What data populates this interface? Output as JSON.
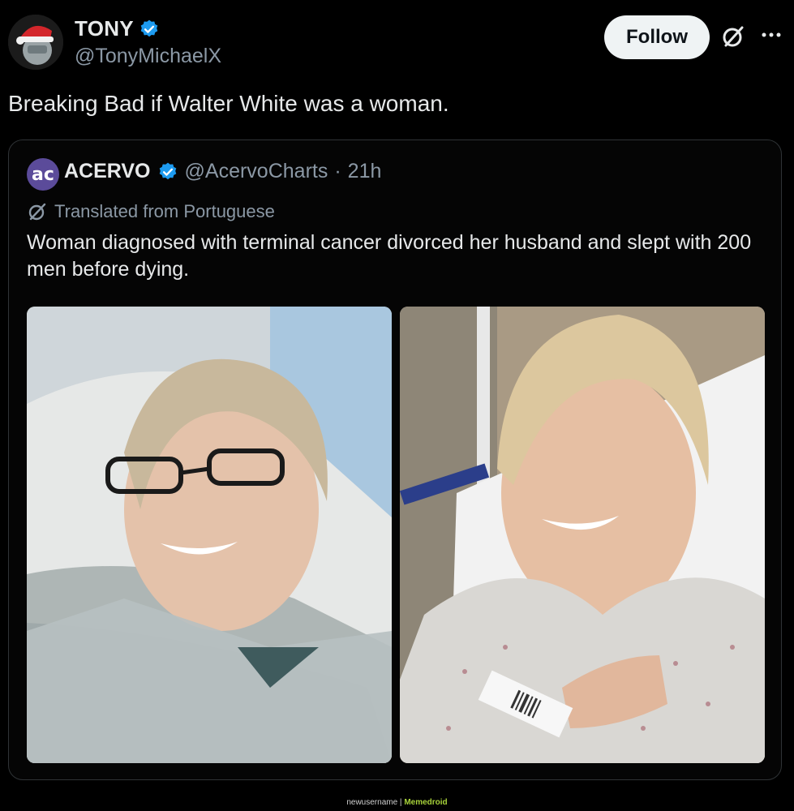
{
  "author": {
    "display_name": "TONY",
    "handle": "@TonyMichaelX",
    "avatar_icon": "avatar-santa-hat-icon",
    "verified_icon": "verified-badge-icon",
    "verified_color": "#1d9bf0"
  },
  "actions": {
    "follow_label": "Follow",
    "grok_icon": "grok-icon",
    "more_icon": "more-icon"
  },
  "tweet": {
    "text": "Breaking Bad if Walter White was a woman."
  },
  "quote": {
    "avatar_text": "ac",
    "display_name": "ACERVO",
    "handle": "@AcervoCharts",
    "separator": "·",
    "time": "21h",
    "translated_label": "Translated from Portuguese",
    "text": "Woman diagnosed with terminal cancer divorced her husband and slept with 200 men before dying.",
    "images": [
      {
        "description_icon": "photo-icon"
      },
      {
        "description_icon": "photo-icon"
      }
    ]
  },
  "watermark": {
    "user": "newusername",
    "separator": "|",
    "brand": "Memedroid"
  }
}
